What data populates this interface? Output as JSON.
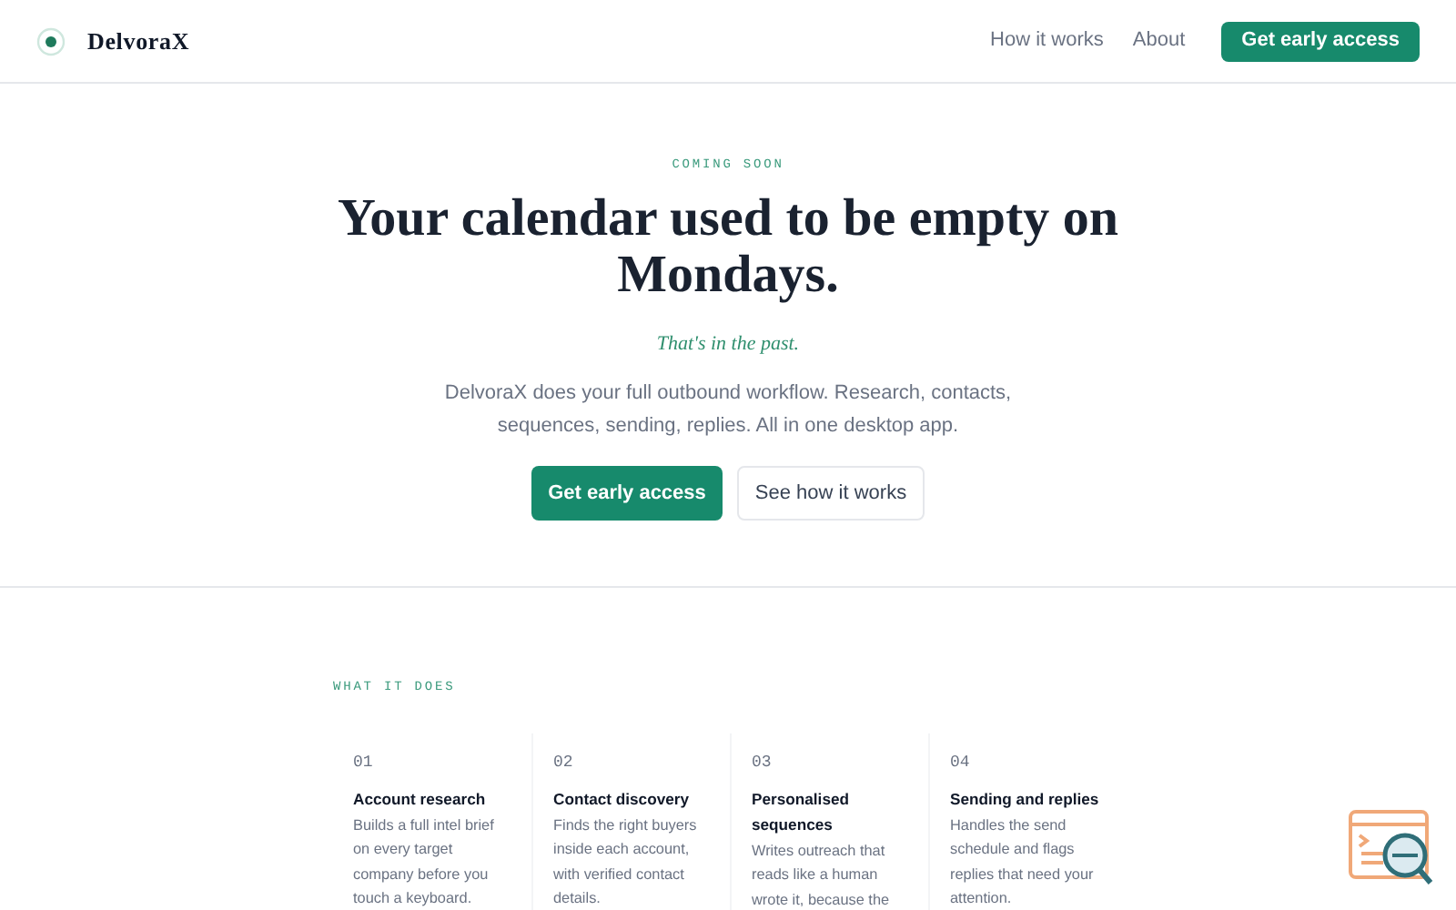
{
  "header": {
    "brand": "DelvoraX",
    "nav": [
      "How it works",
      "About"
    ],
    "cta": "Get early access"
  },
  "hero": {
    "eyebrow": "COMING SOON",
    "title": "Your calendar used to be empty on Mondays.",
    "tagline": "That's in the past.",
    "description": "DelvoraX does your full outbound workflow. Research, contacts, sequences, sending, replies. All in one desktop app.",
    "primary_button": "Get early access",
    "secondary_button": "See how it works"
  },
  "features": {
    "eyebrow": "WHAT IT DOES",
    "items": [
      {
        "number": "01",
        "title": "Account research",
        "text": "Builds a full intel brief on every target company before you touch a keyboard."
      },
      {
        "number": "02",
        "title": "Contact discovery",
        "text": "Finds the right buyers inside each account, with verified contact details."
      },
      {
        "number": "03",
        "title": "Personalised sequences",
        "text": "Writes outreach that reads like a human wrote it, because the"
      },
      {
        "number": "04",
        "title": "Sending and replies",
        "text": "Handles the send schedule and flags replies that need your attention."
      }
    ]
  }
}
